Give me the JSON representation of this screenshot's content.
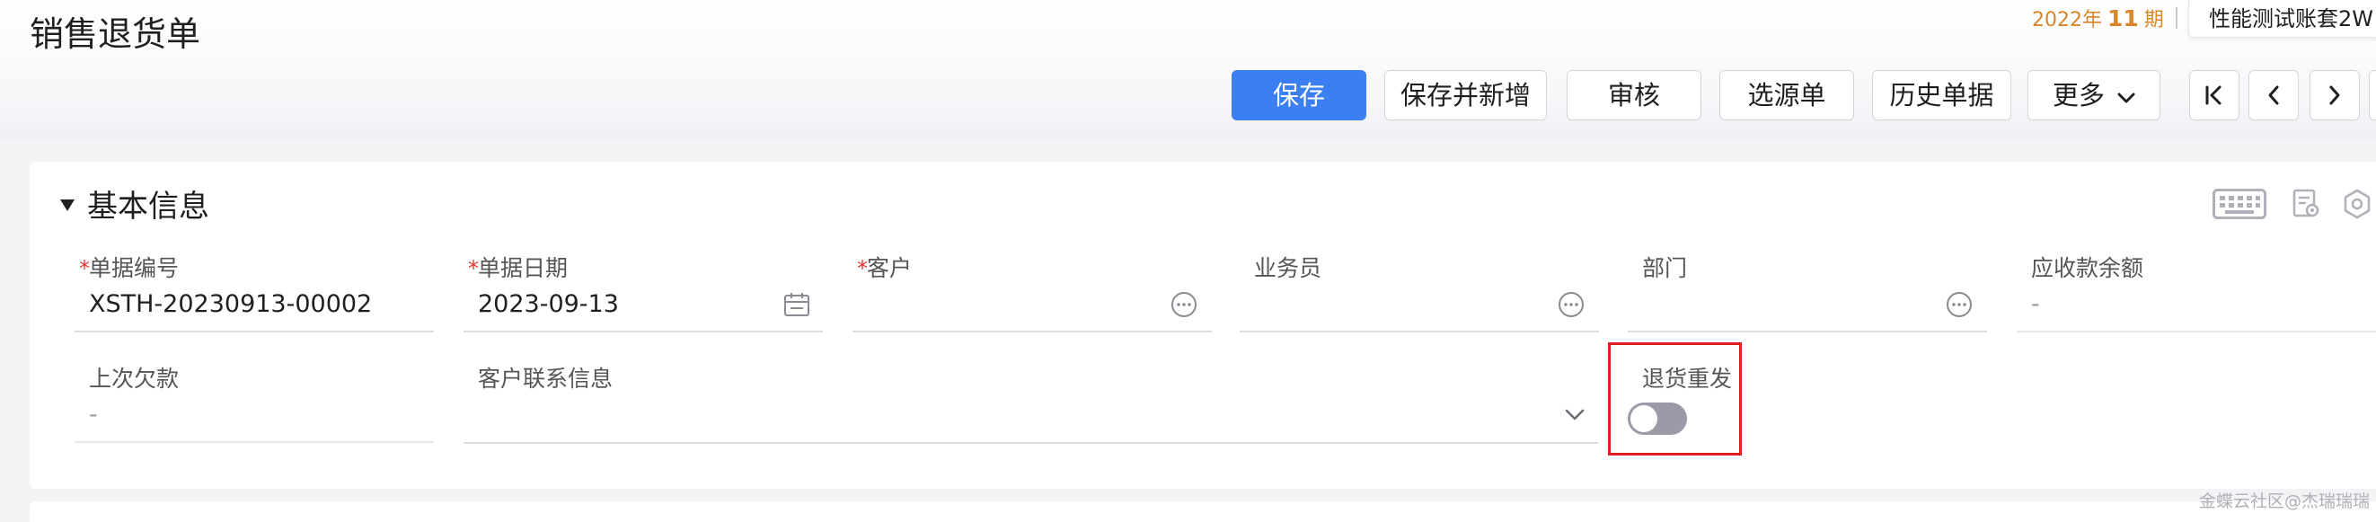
{
  "header": {
    "title": "销售退货单",
    "period": {
      "year": "2022年",
      "number": "11",
      "suffix": "期"
    },
    "account": "性能测试账套2W"
  },
  "toolbar": {
    "save": "保存",
    "save_new": "保存并新增",
    "audit": "审核",
    "select_source": "选源单",
    "history": "历史单据",
    "more": "更多"
  },
  "section": {
    "title": "基本信息"
  },
  "fields": {
    "doc_number": {
      "label": "单据编号",
      "value": "XSTH-20230913-00002",
      "required": "*"
    },
    "doc_date": {
      "label": "单据日期",
      "value": "2023-09-13",
      "required": "*"
    },
    "customer": {
      "label": "客户",
      "value": "",
      "required": "*"
    },
    "salesperson": {
      "label": "业务员",
      "value": ""
    },
    "department": {
      "label": "部门",
      "value": ""
    },
    "receivable_balance": {
      "label": "应收款余额",
      "value": "-"
    },
    "last_debt": {
      "label": "上次欠款",
      "value": "-"
    },
    "customer_contact": {
      "label": "客户联系信息",
      "value": ""
    },
    "return_reship": {
      "label": "退货重发",
      "value": false
    }
  },
  "watermark": "金蝶云社区@杰瑞瑞瑞",
  "colors": {
    "primary": "#3b7ff2",
    "period": "#d9862b",
    "required": "#e53935",
    "highlight": "#e02020",
    "toggle_off": "#9a9aa8"
  },
  "icons": [
    "first-page-icon",
    "prev-page-icon",
    "next-page-icon",
    "keyboard-icon",
    "print-settings-icon",
    "gear-icon",
    "calendar-icon",
    "ellipsis-icon",
    "chevron-down-icon"
  ]
}
